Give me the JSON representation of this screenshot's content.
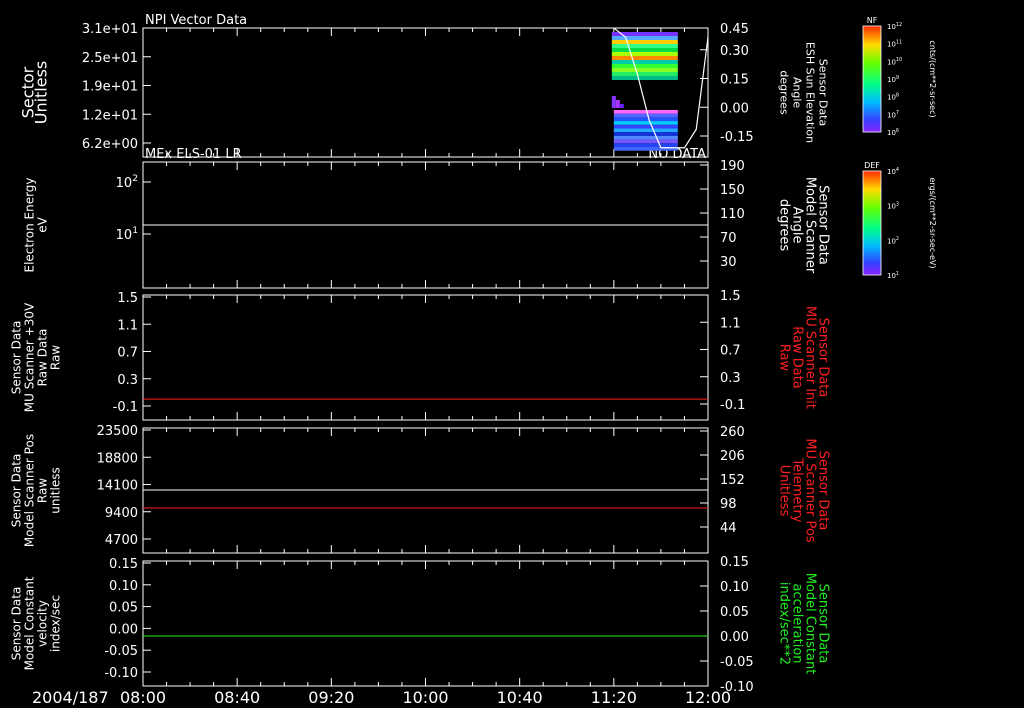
{
  "chart_data": {
    "type": "line",
    "x_date_label": "2004/187",
    "x_ticks": [
      "08:00",
      "08:40",
      "09:20",
      "10:00",
      "10:40",
      "11:20",
      "12:00"
    ],
    "x_range": [
      "08:00",
      "12:00"
    ],
    "panels": [
      {
        "title": "NPI Vector Data",
        "status": "",
        "left_label": [
          "Sector",
          "Unitless"
        ],
        "left_ticks": [
          "3.1e+01",
          "2.5e+01",
          "1.9e+01",
          "1.2e+01",
          "6.2e+00"
        ],
        "right_label": [
          "Sensor Data",
          "ESH Sun Elevation",
          "Angle",
          "degrees"
        ],
        "right_color": "#ffffff",
        "right_ticks": [
          "0.45",
          "0.30",
          "0.15",
          "0.00",
          "-0.15"
        ],
        "right_range": [
          -0.25,
          0.45
        ],
        "spectrogram_start": "11:20",
        "curve": {
          "color": "#ffffff",
          "x": [
            "11:20",
            "11:25",
            "11:30",
            "11:35",
            "11:40",
            "11:45",
            "11:50",
            "11:55",
            "12:00"
          ],
          "values": [
            0.45,
            0.4,
            0.2,
            -0.05,
            -0.2,
            -0.2,
            -0.2,
            -0.1,
            0.4
          ]
        }
      },
      {
        "title": "MEx ELS-01 LR",
        "status": "NO DATA",
        "left_label": [
          "Electron Energy",
          "eV"
        ],
        "left_ticks": [
          "10^2",
          "10^1"
        ],
        "right_label": [
          "Sensor Data",
          "Model Scanner",
          "Angle",
          "degrees"
        ],
        "right_color": "#ffffff",
        "right_ticks": [
          "190",
          "150",
          "110",
          "70",
          "30"
        ],
        "right_range": [
          0,
          190
        ],
        "series": [
          {
            "color": "#ffffff",
            "axis": "right",
            "value": 90
          }
        ]
      },
      {
        "title": "",
        "status": "",
        "left_label": [
          "Sensor Data",
          "MU Scanner +30V",
          "Raw Data",
          "Raw"
        ],
        "left_ticks": [
          "1.5",
          "1.1",
          "0.7",
          "0.3",
          "-0.1"
        ],
        "left_range": [
          -0.3,
          1.5
        ],
        "right_label": [
          "Sensor Data",
          "MU Scanner Init",
          "Raw Data",
          "Raw"
        ],
        "right_color": "#ff2020",
        "right_ticks": [
          "1.5",
          "1.1",
          "0.7",
          "0.3",
          "-0.1"
        ],
        "right_range": [
          -0.3,
          1.5
        ],
        "series": [
          {
            "color": "#ff2020",
            "axis": "right",
            "value": 0.0
          }
        ]
      },
      {
        "title": "",
        "status": "",
        "left_label": [
          "Sensor Data",
          "Model Scanner Pos",
          "Raw",
          "unitless"
        ],
        "left_ticks": [
          "23500",
          "18800",
          "14100",
          "9400",
          "4700"
        ],
        "left_range": [
          0,
          23500
        ],
        "right_label": [
          "Sensor Data",
          "MU Scanner Pos",
          "Telemetry",
          "Unitless"
        ],
        "right_color": "#ff2020",
        "right_ticks": [
          "260",
          "206",
          "152",
          "98",
          "44"
        ],
        "right_range": [
          0,
          260
        ],
        "series": [
          {
            "color": "#ffffff",
            "axis": "left",
            "value": 11500
          },
          {
            "color": "#ff2020",
            "axis": "right",
            "value": 90
          }
        ]
      },
      {
        "title": "",
        "status": "",
        "left_label": [
          "Sensor Data",
          "Model Constant",
          "velocity",
          "index/sec"
        ],
        "left_ticks": [
          "0.15",
          "0.10",
          "0.05",
          "0.00",
          "-0.05",
          "-0.10"
        ],
        "left_range": [
          -0.1,
          0.15
        ],
        "right_label": [
          "Sensor Data",
          "Model Constant",
          "acceleration",
          "index/sec**2"
        ],
        "right_color": "#22ee22",
        "right_ticks": [
          "0.15",
          "0.10",
          "0.05",
          "0.00",
          "-0.05",
          "-0.10"
        ],
        "right_range": [
          -0.1,
          0.15
        ],
        "series": [
          {
            "color": "#22ee22",
            "axis": "right",
            "value": 0.0
          }
        ]
      }
    ],
    "colorbars": [
      {
        "title": "NF",
        "label": "cnts/(cm**2-sr-sec)",
        "ticks": [
          "10^12",
          "10^11",
          "10^10",
          "10^9",
          "10^8",
          "10^7",
          "10^6"
        ]
      },
      {
        "title": "DEF",
        "label": "ergs/(cm**2-sr-sec-eV)",
        "ticks": [
          "10^4",
          "10^3",
          "10^2",
          "10^1"
        ]
      }
    ]
  }
}
